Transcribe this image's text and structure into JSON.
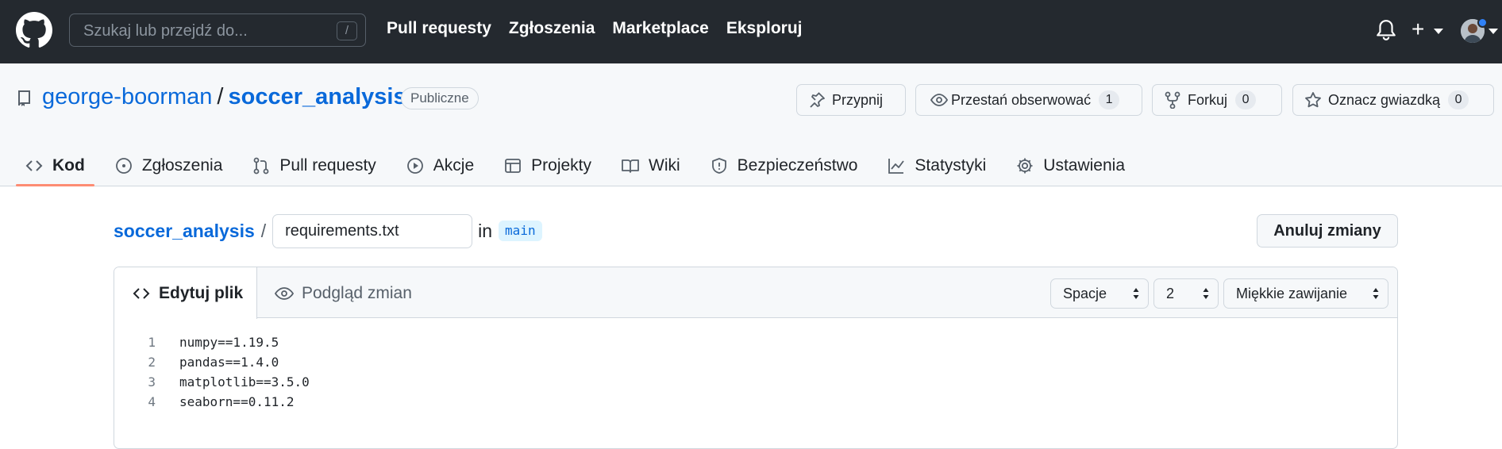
{
  "header": {
    "search_placeholder": "Szukaj lub przejdź do...",
    "search_shortcut": "/",
    "nav": [
      "Pull requesty",
      "Zgłoszenia",
      "Marketplace",
      "Eksploruj"
    ],
    "icons": [
      "github-logo-icon",
      "bell-icon",
      "plus-icon",
      "avatar"
    ]
  },
  "repo": {
    "owner": "george-boorman",
    "separator": "/",
    "name": "soccer_analysis",
    "visibility": "Publiczne",
    "actions": {
      "pin": "Przypnij",
      "watch": "Przestań obserwować",
      "watch_count": "1",
      "fork": "Forkuj",
      "fork_count": "0",
      "star": "Oznacz gwiazdką",
      "star_count": "0"
    },
    "tabs": [
      "Kod",
      "Zgłoszenia",
      "Pull requesty",
      "Akcje",
      "Projekty",
      "Wiki",
      "Bezpieczeństwo",
      "Statystyki",
      "Ustawienia"
    ],
    "active_tab": "Kod"
  },
  "edit": {
    "repo_link": "soccer_analysis",
    "slash": "/",
    "filename": "requirements.txt",
    "in_label": "in",
    "branch": "main",
    "cancel_label": "Anuluj zmiany",
    "tab_edit": "Edytuj plik",
    "tab_preview": "Podgląd zmian",
    "indent_mode": "Spacje",
    "indent_size": "2",
    "wrap_mode": "Miękkie zawijanie",
    "lines": [
      {
        "n": "1",
        "text": "numpy==1.19.5"
      },
      {
        "n": "2",
        "text": "pandas==1.4.0"
      },
      {
        "n": "3",
        "text": "matplotlib==3.5.0"
      },
      {
        "n": "4",
        "text": "seaborn==0.11.2"
      }
    ]
  },
  "colors": {
    "header_bg": "#24292f",
    "link": "#0969da",
    "active_tab_underline": "#fd8c73",
    "notification_dot": "#2f81f7"
  }
}
